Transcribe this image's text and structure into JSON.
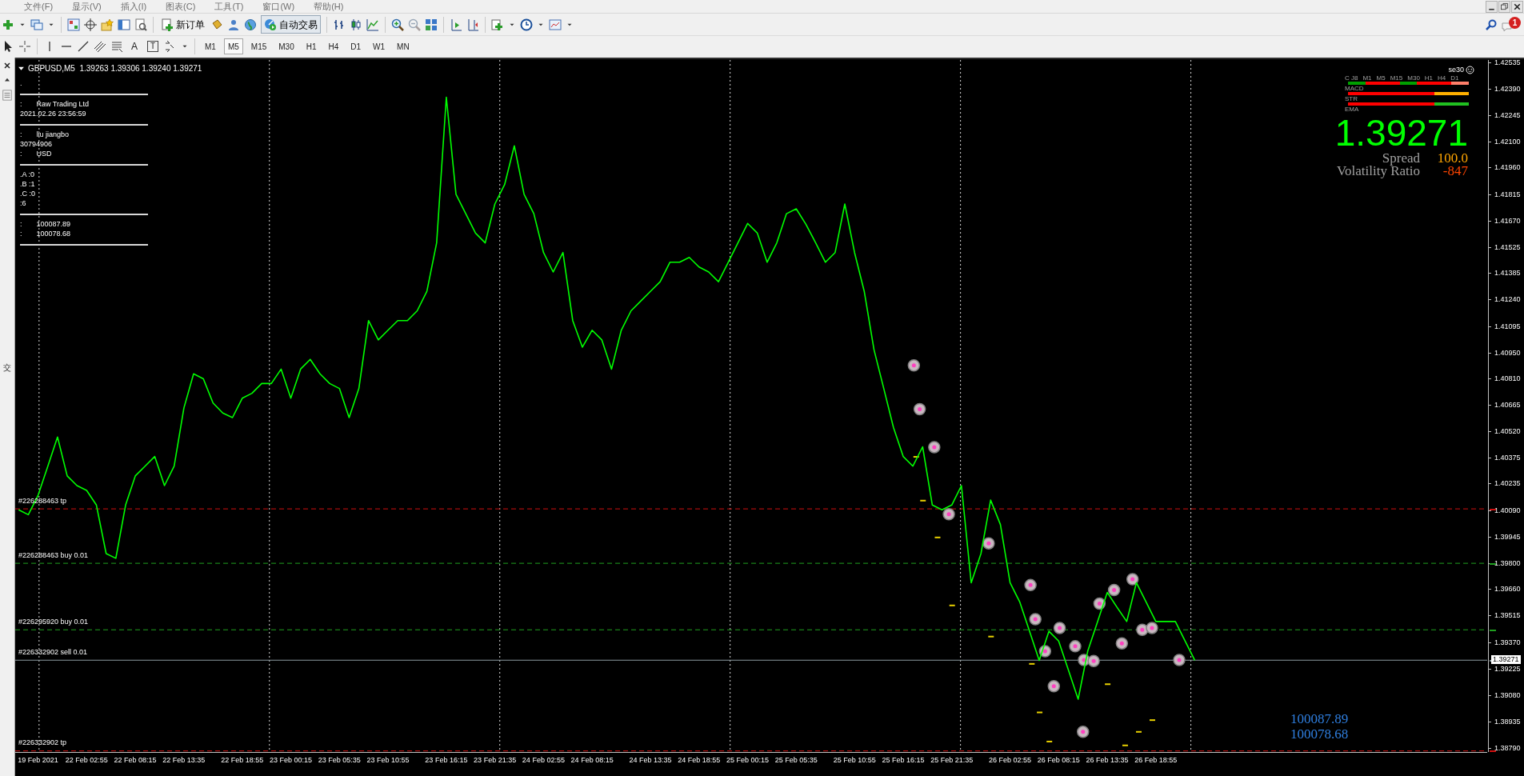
{
  "menu": [
    "文件(F)",
    "显示(V)",
    "插入(I)",
    "图表(C)",
    "工具(T)",
    "窗口(W)",
    "帮助(H)"
  ],
  "toolbar": {
    "new_order": "新订单",
    "auto_trading": "自动交易",
    "notification_count": "1"
  },
  "drawing_toolbar": {
    "text_tool": "A",
    "label_tool": "T"
  },
  "timeframes": [
    {
      "label": "M1",
      "selected": false
    },
    {
      "label": "M5",
      "selected": true
    },
    {
      "label": "M15",
      "selected": false
    },
    {
      "label": "M30",
      "selected": false
    },
    {
      "label": "H1",
      "selected": false
    },
    {
      "label": "H4",
      "selected": false
    },
    {
      "label": "D1",
      "selected": false
    },
    {
      "label": "W1",
      "selected": false
    },
    {
      "label": "MN",
      "selected": false
    }
  ],
  "side_tab": "交",
  "chart": {
    "title": "GBPUSD,M5  1.39263 1.39306 1.39240 1.39271",
    "info_panel": [
      {
        "kind": "text",
        "text": "."
      },
      {
        "kind": "rule"
      },
      {
        "kind": "text",
        "prefix": ":",
        "text": "Raw Trading Ltd"
      },
      {
        "kind": "text",
        "text": "2021.02.26 23:56:59"
      },
      {
        "kind": "rule"
      },
      {
        "kind": "text",
        "prefix": ":",
        "text": "liu jiangbo"
      },
      {
        "kind": "text",
        "text": "30794906"
      },
      {
        "kind": "text",
        "prefix": ":",
        "text": "USD"
      },
      {
        "kind": "rule"
      },
      {
        "kind": "text",
        "text": ".A :0"
      },
      {
        "kind": "text",
        "text": ".B :1"
      },
      {
        "kind": "text",
        "text": ".C :0"
      },
      {
        "kind": "text",
        "text": ":6"
      },
      {
        "kind": "rule"
      },
      {
        "kind": "text",
        "prefix": ":",
        "text": "100087.89"
      },
      {
        "kind": "text",
        "prefix": ":",
        "text": "100078.68"
      },
      {
        "kind": "rule"
      }
    ],
    "ea_name": "se30",
    "signal_panel": {
      "header": "C J8",
      "timeframes": [
        "M1",
        "M5",
        "M15",
        "M30",
        "H1",
        "H4",
        "D1"
      ],
      "rows": [
        {
          "label": "",
          "segments": [
            {
              "color": "#00a000"
            },
            {
              "color": "#ff0000"
            },
            {
              "color": "#ff0000"
            },
            {
              "color": "#00a000"
            },
            {
              "color": "#ff0000"
            },
            {
              "color": "#ff0000"
            },
            {
              "color": "#ff7f6a"
            }
          ]
        },
        {
          "label": "MACD",
          "segments": [
            {
              "color": "#ff0000"
            },
            {
              "color": "#ff0000"
            },
            {
              "color": "#ff0000"
            },
            {
              "color": "#ff0000"
            },
            {
              "color": "#ff0000"
            },
            {
              "color": "#ffb000"
            },
            {
              "color": "#ffb000"
            }
          ]
        },
        {
          "label": "STR",
          "segments": [
            {
              "color": "#ff0000"
            },
            {
              "color": "#ff0000"
            },
            {
              "color": "#ff0000"
            },
            {
              "color": "#ff0000"
            },
            {
              "color": "#ff0000"
            },
            {
              "color": "#20c020"
            },
            {
              "color": "#20c020"
            }
          ]
        },
        {
          "label": "EMA",
          "segments": []
        }
      ]
    },
    "big_price": "1.39271",
    "spread_label": "Spread",
    "spread_value": "100.0",
    "volatility_label": "Volatility Ratio",
    "volatility_value": "-847",
    "balance_lines": [
      "100087.89",
      "100078.68"
    ],
    "current_price_tag": "1.39271",
    "chart_data": {
      "type": "line",
      "grid": true,
      "categories": [
        null,
        null,
        "19 Feb 2021",
        null,
        null,
        null,
        null,
        "22 Feb 02:55",
        null,
        null,
        null,
        null,
        "22 Feb 08:15",
        null,
        null,
        null,
        null,
        "22 Feb 13:35",
        null,
        null,
        null,
        null,
        null,
        "22 Feb 18:55",
        null,
        null,
        null,
        null,
        "23 Feb 00:15",
        null,
        null,
        null,
        null,
        "23 Feb 05:35",
        null,
        null,
        null,
        null,
        "23 Feb 10:55",
        null,
        null,
        null,
        null,
        null,
        "23 Feb 16:15",
        null,
        null,
        null,
        null,
        "23 Feb 21:35",
        null,
        null,
        null,
        null,
        "24 Feb 02:55",
        null,
        null,
        null,
        null,
        "24 Feb 08:15",
        null,
        null,
        null,
        null,
        null,
        "24 Feb 13:35",
        null,
        null,
        null,
        null,
        "24 Feb 18:55",
        null,
        null,
        null,
        null,
        "25 Feb 00:15",
        null,
        null,
        null,
        null,
        "25 Feb 05:35",
        null,
        null,
        null,
        null,
        null,
        "25 Feb 10:55",
        null,
        null,
        null,
        null,
        "25 Feb 16:15",
        null,
        null,
        null,
        null,
        "25 Feb 21:35",
        null,
        null,
        null,
        null,
        null,
        "26 Feb 02:55",
        null,
        null,
        null,
        null,
        "26 Feb 08:15",
        null,
        null,
        null,
        null,
        "26 Feb 13:35",
        null,
        null,
        null,
        null,
        "26 Feb 18:55",
        null,
        null,
        null,
        null
      ],
      "ylim": [
        1.3877,
        1.42547
      ],
      "yticks": [
        {
          "value": 1.42535,
          "label": "1.42535"
        },
        {
          "value": 1.4239,
          "label": "1.42390"
        },
        {
          "value": 1.42245,
          "label": "1.42245"
        },
        {
          "value": 1.421,
          "label": "1.42100"
        },
        {
          "value": 1.4196,
          "label": "1.41960"
        },
        {
          "value": 1.41815,
          "label": "1.41815"
        },
        {
          "value": 1.4167,
          "label": "1.41670"
        },
        {
          "value": 1.41525,
          "label": "1.41525"
        },
        {
          "value": 1.41385,
          "label": "1.41385"
        },
        {
          "value": 1.4124,
          "label": "1.41240"
        },
        {
          "value": 1.41095,
          "label": "1.41095"
        },
        {
          "value": 1.4095,
          "label": "1.40950"
        },
        {
          "value": 1.4081,
          "label": "1.40810"
        },
        {
          "value": 1.40665,
          "label": "1.40665"
        },
        {
          "value": 1.4052,
          "label": "1.40520"
        },
        {
          "value": 1.40375,
          "label": "1.40375"
        },
        {
          "value": 1.40235,
          "label": "1.40235"
        },
        {
          "value": 1.4009,
          "label": "1.40090"
        },
        {
          "value": 1.39945,
          "label": "1.39945"
        },
        {
          "value": 1.398,
          "label": "1.39800"
        },
        {
          "value": 1.3966,
          "label": "1.39660"
        },
        {
          "value": 1.39515,
          "label": "1.39515"
        },
        {
          "value": 1.3937,
          "label": "1.39370"
        },
        {
          "value": 1.39225,
          "label": "1.39225"
        },
        {
          "value": 1.3908,
          "label": "1.39080"
        },
        {
          "value": 1.38935,
          "label": "1.38935"
        },
        {
          "value": 1.3879,
          "label": "1.38790"
        }
      ],
      "series": [
        {
          "color": "#00ff00",
          "values": [
            1.40092,
            1.40065,
            1.40171,
            1.4033,
            1.40489,
            1.40277,
            1.40224,
            1.40198,
            1.40118,
            1.39853,
            1.39827,
            1.40118,
            1.40277,
            1.4033,
            1.40383,
            1.40224,
            1.4033,
            1.40648,
            1.40834,
            1.40807,
            1.40675,
            1.4062,
            1.40595,
            1.40701,
            1.40728,
            1.40781,
            1.40781,
            1.4086,
            1.40701,
            1.4086,
            1.40913,
            1.40834,
            1.40781,
            1.40754,
            1.40595,
            1.40754,
            1.41125,
            1.41019,
            1.41072,
            1.41125,
            1.41125,
            1.41178,
            1.41284,
            1.41549,
            1.42344,
            1.41814,
            1.41708,
            1.41602,
            1.41549,
            1.41761,
            1.41867,
            1.42079,
            1.41814,
            1.41708,
            1.41496,
            1.4139,
            1.41496,
            1.41125,
            1.4098,
            1.41072,
            1.41019,
            1.4086,
            1.41072,
            1.41178,
            1.41231,
            1.41284,
            1.41337,
            1.41443,
            1.41443,
            1.4147,
            1.41417,
            1.4139,
            1.41337,
            1.41443,
            1.41549,
            1.41655,
            1.41602,
            1.41443,
            1.41549,
            1.41708,
            1.41735,
            1.4165,
            1.41549,
            1.41443,
            1.41496,
            1.41761,
            1.41496,
            1.41284,
            1.40966,
            1.40754,
            1.40542,
            1.40383,
            1.4033,
            1.40436,
            1.40118,
            1.40092,
            1.40118,
            1.40224,
            1.39694,
            1.39853,
            1.40145,
            1.40012,
            1.39694,
            1.39588,
            1.39429,
            1.3927,
            1.39429,
            1.39376,
            1.39217,
            1.39058,
            1.39323,
            1.39482,
            1.39641,
            1.3956,
            1.39482,
            1.39694,
            1.39588,
            1.39482,
            1.39482,
            1.39482,
            1.39376,
            1.39271
          ]
        }
      ],
      "ref_lines": [
        {
          "axis": "y",
          "value": 1.40097,
          "label": "#226288463 tp",
          "color": "#d01010"
        },
        {
          "axis": "y",
          "value": 1.398,
          "label": "#226288463 buy 0.01",
          "color": "#20a020"
        },
        {
          "axis": "y",
          "value": 1.39437,
          "label": "#226295920 buy 0.01",
          "color": "#20a020"
        },
        {
          "axis": "y",
          "value": 1.39271,
          "label": "#226332902 sell 0.01",
          "color": "#8a9aa0"
        },
        {
          "axis": "y",
          "value": 1.38776,
          "label": "#226332902 tp",
          "color": "#d01010"
        }
      ]
    }
  }
}
